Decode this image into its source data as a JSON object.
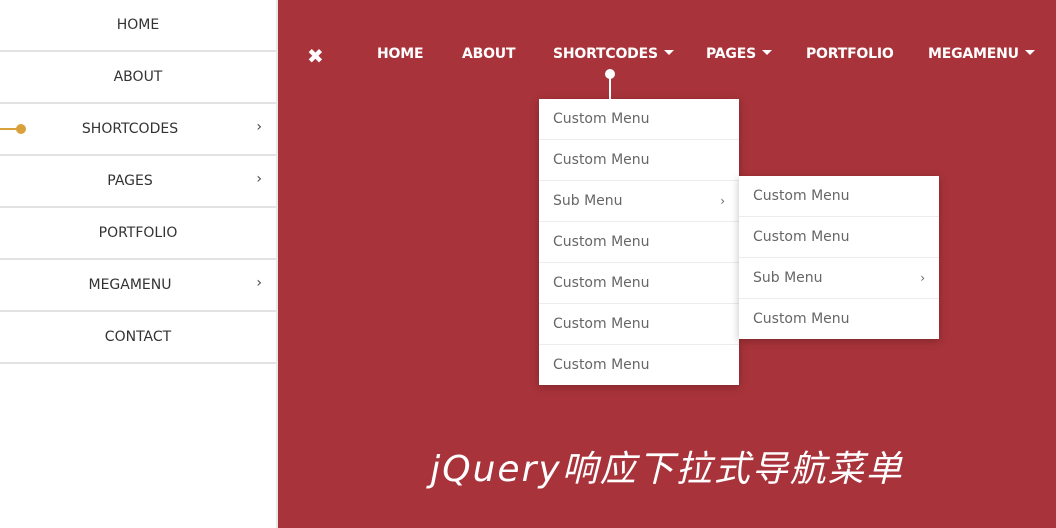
{
  "sidebar": {
    "items": [
      {
        "label": "HOME",
        "has_submenu": false
      },
      {
        "label": "ABOUT",
        "has_submenu": false
      },
      {
        "label": "SHORTCODES",
        "has_submenu": true,
        "active": true
      },
      {
        "label": "PAGES",
        "has_submenu": true
      },
      {
        "label": "PORTFOLIO",
        "has_submenu": false
      },
      {
        "label": "MEGAMENU",
        "has_submenu": true
      },
      {
        "label": "CONTACT",
        "has_submenu": false
      }
    ],
    "chevron": "›"
  },
  "topnav": {
    "close_icon": "✖",
    "items": [
      {
        "label": "HOME",
        "dropdown": false
      },
      {
        "label": "ABOUT",
        "dropdown": false
      },
      {
        "label": "SHORTCODES",
        "dropdown": true
      },
      {
        "label": "PAGES",
        "dropdown": true
      },
      {
        "label": "PORTFOLIO",
        "dropdown": false
      },
      {
        "label": "MEGAMENU",
        "dropdown": true
      }
    ]
  },
  "dropdown": {
    "items": [
      {
        "label": "Custom Menu"
      },
      {
        "label": "Custom Menu"
      },
      {
        "label": "Sub Menu",
        "has_submenu": true
      },
      {
        "label": "Custom Menu"
      },
      {
        "label": "Custom Menu"
      },
      {
        "label": "Custom Menu"
      },
      {
        "label": "Custom Menu"
      }
    ],
    "submenu": {
      "items": [
        {
          "label": "Custom Menu"
        },
        {
          "label": "Custom Menu"
        },
        {
          "label": "Sub Menu",
          "has_submenu": true
        },
        {
          "label": "Custom Menu"
        }
      ]
    },
    "chevron": "›"
  },
  "hero": {
    "title": "jQuery响应下拉式导航菜单"
  },
  "colors": {
    "background": "#a8333a",
    "accent": "#d9a13c",
    "sidebar_bg": "#ffffff"
  }
}
